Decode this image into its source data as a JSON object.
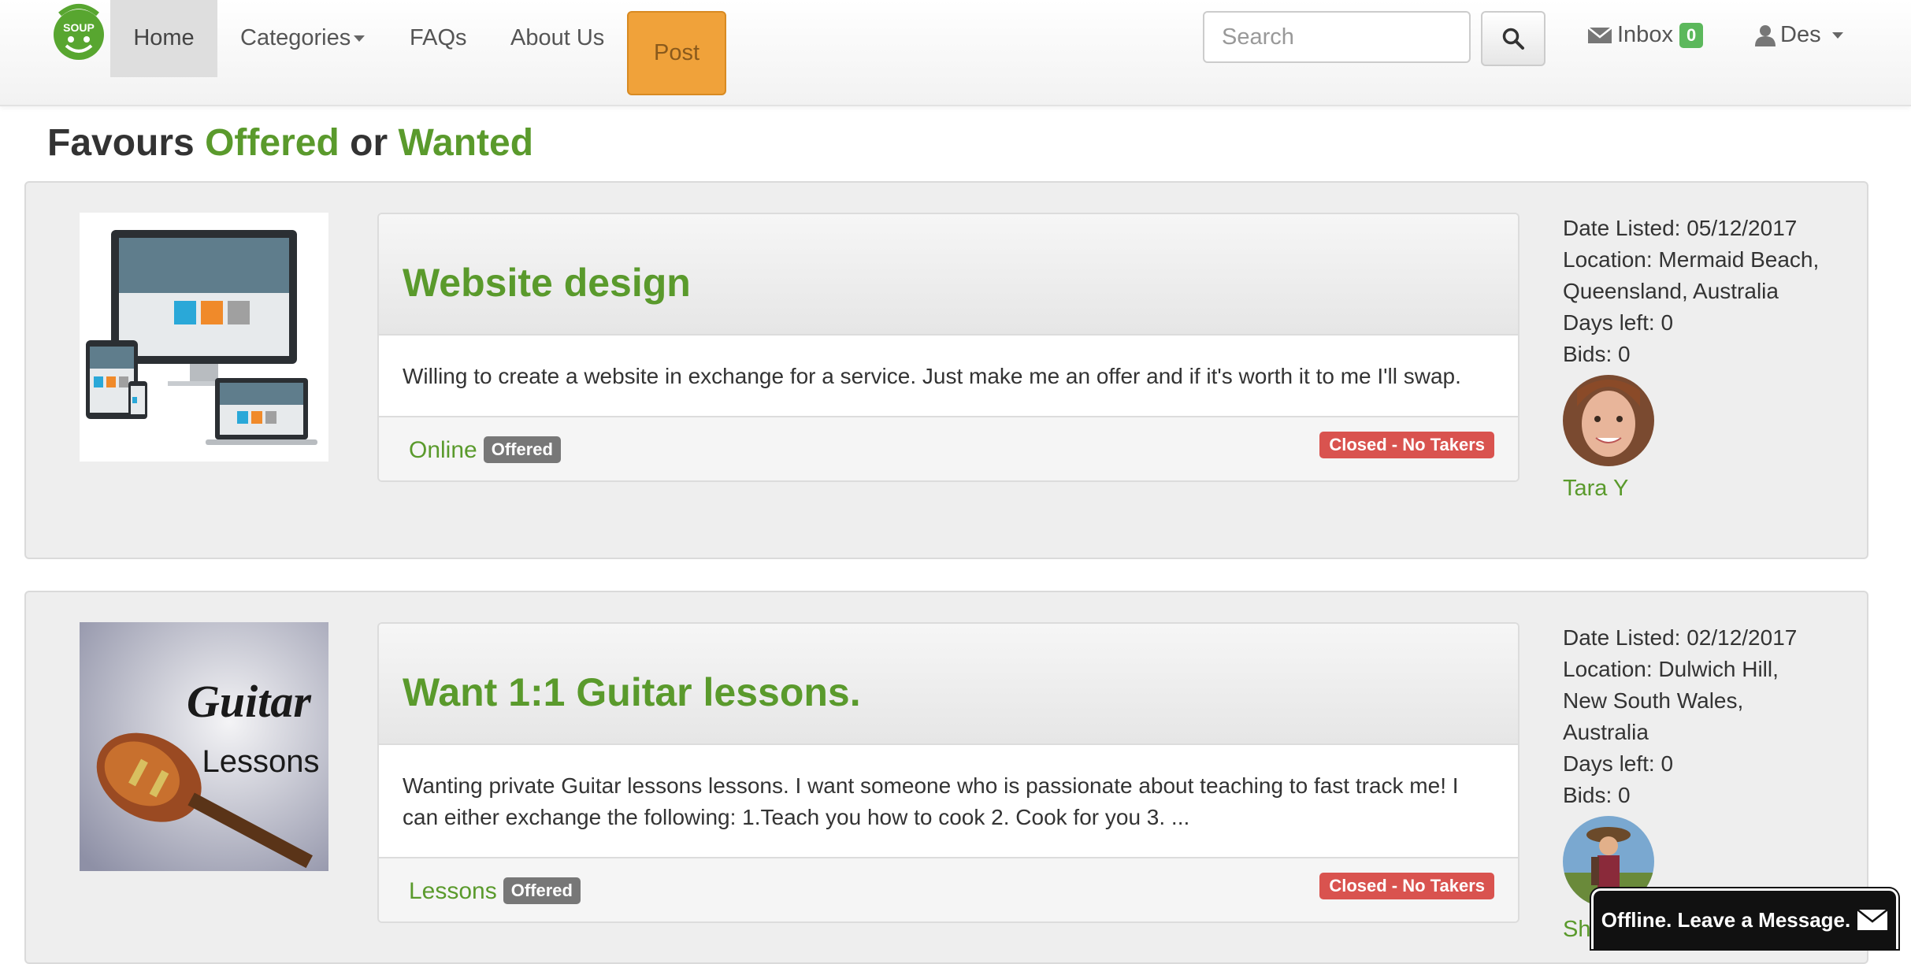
{
  "nav": {
    "logo_text": "FAVOUR SOUP",
    "home": "Home",
    "categories": "Categories",
    "faqs": "FAQs",
    "about": "About Us",
    "post": "Post",
    "search_placeholder": "Search",
    "inbox_label": "Inbox",
    "inbox_count": "0",
    "user": "Des"
  },
  "page": {
    "title_part1": "Favours",
    "title_offered": "Offered",
    "title_or": "or",
    "title_wanted": "Wanted"
  },
  "listings": [
    {
      "title": "Website design",
      "description": "Willing to create a website in exchange for a service. Just make me an offer and if it's worth it to me I'll swap.",
      "category": "Online",
      "type": "Offered",
      "status": "Closed - No Takers",
      "date_listed": "Date Listed: 05/12/2017",
      "location": "Location: Mermaid Beach, Queensland, Australia",
      "days_left": "Days left: 0",
      "bids": "Bids: 0",
      "user": "Tara Y"
    },
    {
      "title": "Want 1:1 Guitar lessons.",
      "description": "Wanting private Guitar lessons lessons. I want someone who is passionate about teaching to fast track me! I can either exchange the following: 1.Teach you how to cook 2. Cook for you 3. ...",
      "category": "Lessons",
      "type": "Offered",
      "status": "Closed - No Takers",
      "date_listed": "Date Listed: 02/12/2017",
      "location": "Location: Dulwich Hill, New South Wales, Australia",
      "days_left": "Days left: 0",
      "bids": "Bids: 0",
      "user": "Sh",
      "thumb_text_1": "Guitar",
      "thumb_text_2": "Lessons"
    }
  ],
  "chat": {
    "label": "Offline. Leave a Message."
  },
  "colors": {
    "brand_green": "#5a9a2c",
    "post_orange": "#f0a23a",
    "closed_red": "#d9534f",
    "badge_grey": "#777777"
  }
}
